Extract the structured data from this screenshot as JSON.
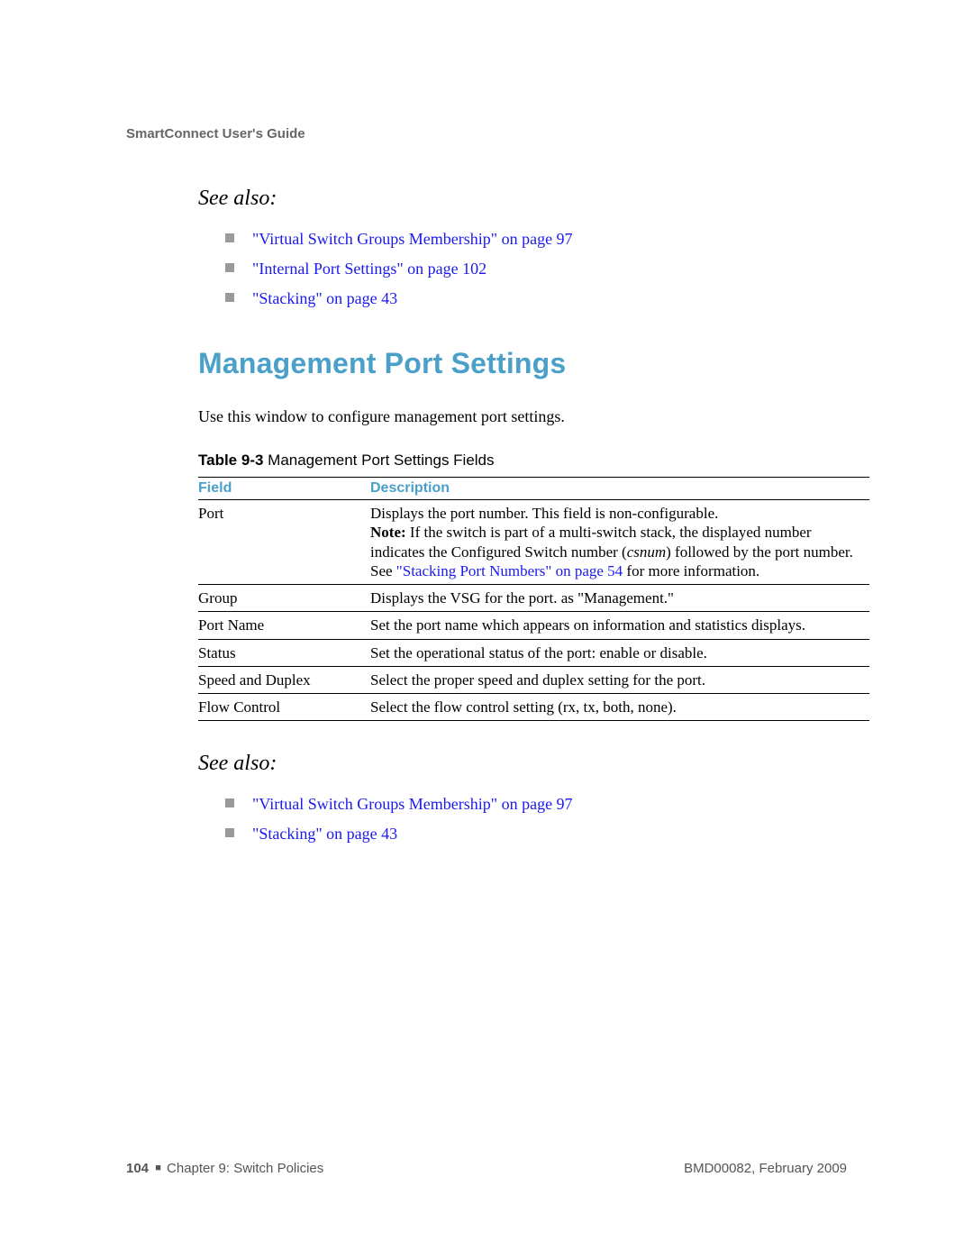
{
  "header": {
    "guide_title": "SmartConnect User's Guide"
  },
  "see_also_1": {
    "heading": "See also:",
    "links": [
      "\"Virtual Switch Groups Membership\" on page 97",
      "\"Internal Port Settings\" on page 102",
      "\"Stacking\" on page 43"
    ]
  },
  "main": {
    "title": "Management Port Settings",
    "intro": "Use this window to configure management port settings.",
    "table_caption_label": "Table 9-3",
    "table_caption_rest": "  Management Port Settings Fields",
    "columns": {
      "field": "Field",
      "description": "Description"
    },
    "rows": [
      {
        "field": "Port",
        "desc_line1": "Displays the port number. This field is non-configurable.",
        "note_label": "Note:",
        "note_before": " If the switch is part of a multi-switch stack, the displayed number indicates the Configured Switch number (",
        "note_italic": "csnum",
        "note_mid": ") followed by the port number. See ",
        "note_link": "\"Stacking Port Numbers\" on page 54",
        "note_after": " for more information."
      },
      {
        "field": "Group",
        "desc": "Displays the VSG for the port. as \"Management.\""
      },
      {
        "field": "Port Name",
        "desc": "Set the port name which appears on information and statistics displays."
      },
      {
        "field": "Status",
        "desc": "Set the operational status of the port: enable or disable."
      },
      {
        "field": "Speed and Duplex",
        "desc": "Select the proper speed and duplex setting for the port."
      },
      {
        "field": "Flow Control",
        "desc": "Select the flow control setting (rx, tx, both, none)."
      }
    ]
  },
  "see_also_2": {
    "heading": "See also:",
    "links": [
      "\"Virtual Switch Groups Membership\" on page 97",
      "\"Stacking\" on page 43"
    ]
  },
  "footer": {
    "page_num": "104",
    "chapter": "Chapter 9: Switch Policies",
    "docid": "BMD00082, February 2009"
  }
}
